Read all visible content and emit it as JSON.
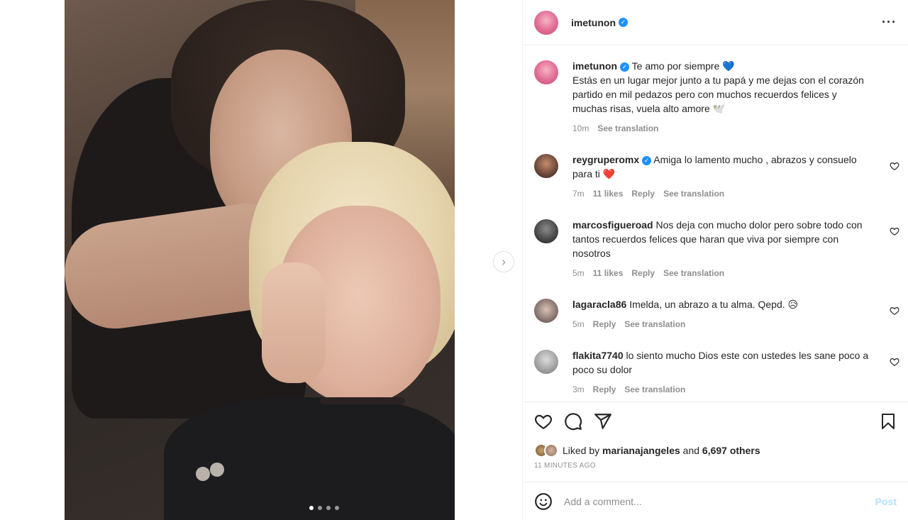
{
  "post": {
    "author": "imetunon",
    "caption_lead": "Te amo por siempre 💙",
    "caption_body": "Estás en un lugar mejor junto a tu papá y me dejas con el corazón partido en mil pedazos pero con muchos recuerdos felices y muchas risas, vuela alto amore 🕊️",
    "caption_time": "10m",
    "see_translation": "See translation",
    "carousel_dots": 4,
    "carousel_active": 1
  },
  "comments": [
    {
      "user": "reygruperomx",
      "verified": true,
      "text": "Amiga lo lamento mucho , abrazos y consuelo para ti ❤️",
      "time": "7m",
      "likes": "11 likes",
      "reply": "Reply",
      "translate": "See translation"
    },
    {
      "user": "marcosfigueroad",
      "verified": false,
      "text": "Nos deja con mucho dolor pero sobre todo con tantos recuerdos felices que haran que viva por siempre con nosotros",
      "time": "5m",
      "likes": "11 likes",
      "reply": "Reply",
      "translate": "See translation"
    },
    {
      "user": "lagaracla86",
      "verified": false,
      "text": "Imelda, un abrazo a tu alma. Qepd. 😥",
      "time": "5m",
      "likes": "",
      "reply": "Reply",
      "translate": "See translation"
    },
    {
      "user": "flakita7740",
      "verified": false,
      "text": "lo siento mucho Dios este con ustedes les sane poco a poco su dolor",
      "time": "3m",
      "likes": "",
      "reply": "Reply",
      "translate": "See translation"
    }
  ],
  "likes": {
    "prefix": "Liked by",
    "user": "marianajangeles",
    "middle": "and",
    "others": "6,697 others"
  },
  "timestamp": "11 minutes ago",
  "composer": {
    "placeholder": "Add a comment...",
    "post_label": "Post"
  },
  "icons": {
    "more": "more-options-icon",
    "like": "heart-icon",
    "comment": "comment-icon",
    "share": "share-icon",
    "save": "bookmark-icon",
    "emoji": "emoji-icon",
    "next": "chevron-right-icon"
  },
  "colors": {
    "verified": "#1e90ff",
    "muted": "#8e8e8e",
    "post_disabled": "#b2dffc"
  }
}
